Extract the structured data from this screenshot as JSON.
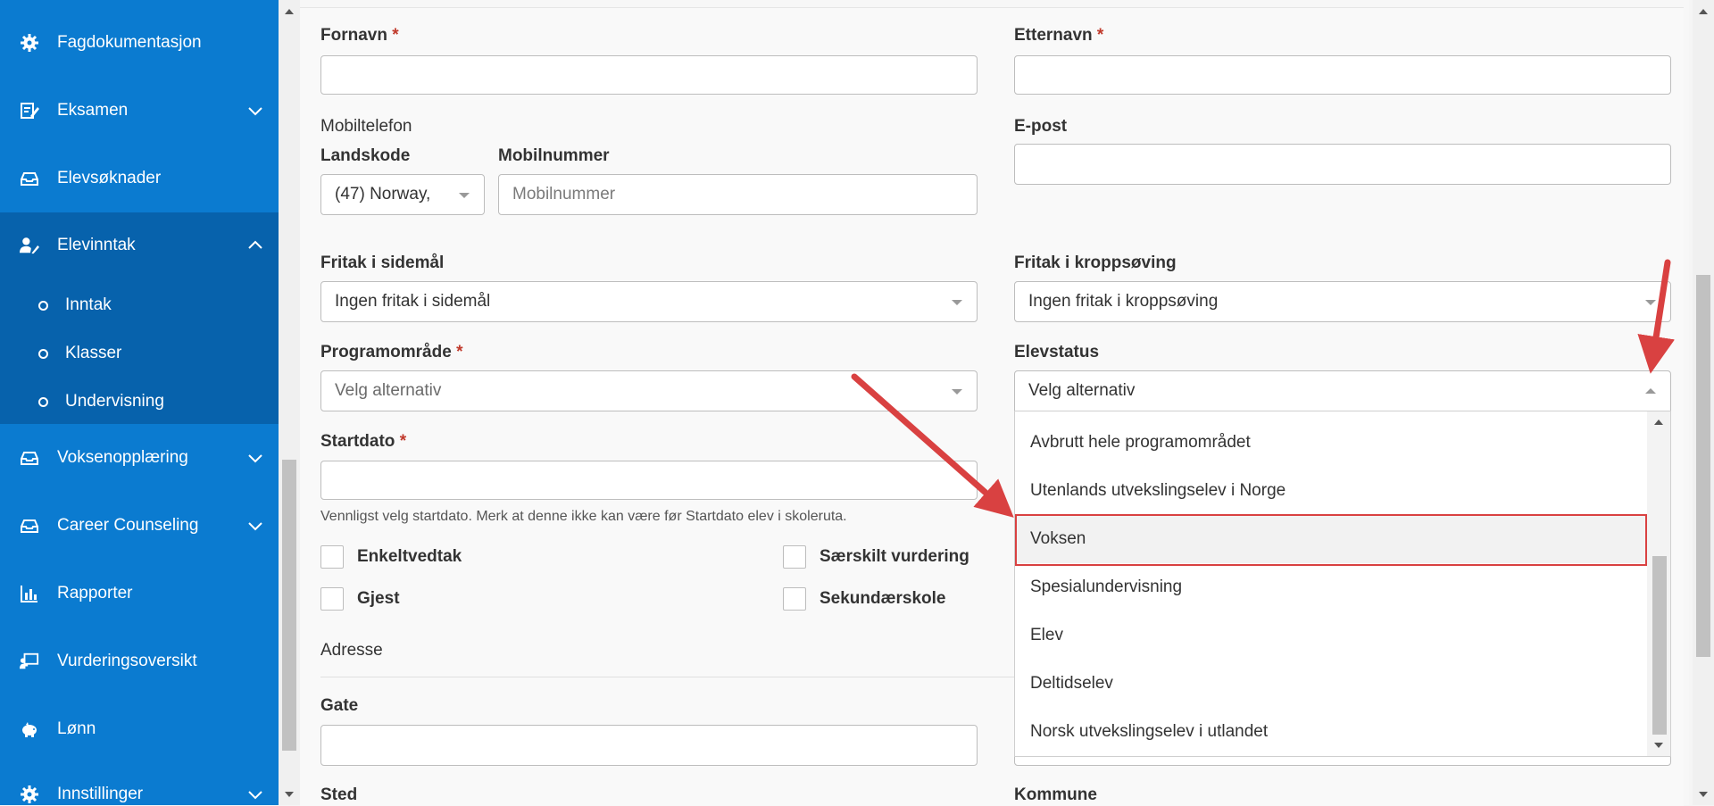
{
  "sidebar": {
    "items": [
      {
        "label": "Fagdokumentasjon",
        "icon": "gear-icon"
      },
      {
        "label": "Eksamen",
        "icon": "edit-icon"
      },
      {
        "label": "Elevsøknader",
        "icon": "inbox-icon"
      },
      {
        "label": "Elevinntak",
        "icon": "user-edit-icon"
      },
      {
        "label": "Voksenopplæring",
        "icon": "inbox-icon"
      },
      {
        "label": "Career Counseling",
        "icon": "inbox-icon"
      },
      {
        "label": "Rapporter",
        "icon": "bar-chart-icon"
      },
      {
        "label": "Vurderingsoversikt",
        "icon": "presentation-icon"
      },
      {
        "label": "Lønn",
        "icon": "piggy-bank-icon"
      },
      {
        "label": "Innstillinger",
        "icon": "gear-icon"
      }
    ],
    "subitems": [
      {
        "label": "Inntak"
      },
      {
        "label": "Klasser"
      },
      {
        "label": "Undervisning"
      }
    ]
  },
  "form": {
    "fornavn": {
      "label": "Fornavn",
      "required": "*",
      "value": ""
    },
    "etternavn": {
      "label": "Etternavn",
      "required": "*",
      "value": ""
    },
    "mobiltelefon_label": "Mobiltelefon",
    "landskode": {
      "label": "Landskode",
      "value": "(47) Norway,"
    },
    "mobilnummer": {
      "label": "Mobilnummer",
      "placeholder": "Mobilnummer"
    },
    "epost": {
      "label": "E-post",
      "value": ""
    },
    "fritak_sidemal": {
      "label": "Fritak i sidemål",
      "value": "Ingen fritak i sidemål"
    },
    "fritak_kroppsoving": {
      "label": "Fritak i kroppsøving",
      "value": "Ingen fritak i kroppsøving"
    },
    "programomrade": {
      "label": "Programområde",
      "required": "*",
      "value": "Velg alternativ"
    },
    "elevstatus": {
      "label": "Elevstatus",
      "value": "Velg alternativ"
    },
    "startdato": {
      "label": "Startdato",
      "required": "*",
      "value": "",
      "help": "Vennligst velg startdato. Merk at denne ikke kan være før Startdato elev i skoleruta."
    },
    "checkboxes": {
      "enkeltvedtak": "Enkeltvedtak",
      "gjest": "Gjest",
      "saerskilt": "Særskilt vurdering",
      "sekundarskole": "Sekundærskole"
    },
    "adresse_section": "Adresse",
    "gate": {
      "label": "Gate",
      "value": ""
    },
    "sted": {
      "label": "Sted"
    },
    "kommune": {
      "label": "Kommune"
    }
  },
  "elevstatus_options": [
    "Avbrutt hele programområdet",
    "Utenlands utvekslingselev i Norge",
    "Voksen",
    "Spesialundervisning",
    "Elev",
    "Deltidselev",
    "Norsk utvekslingselev i utlandet"
  ],
  "highlighted_option": "Voksen",
  "colors": {
    "sidebar": "#0b7bd0",
    "sidebar_active": "#0762ac",
    "required": "#c0392b",
    "annotation": "#d94141"
  }
}
